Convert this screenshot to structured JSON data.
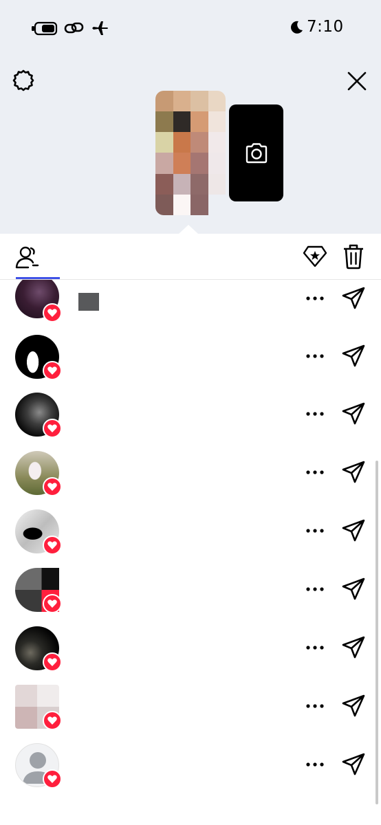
{
  "status_bar": {
    "time": "7:10",
    "icons": [
      "battery-icon",
      "link-icon",
      "airplane-icon",
      "moon-icon"
    ]
  },
  "header": {
    "left_icon": "gear-icon",
    "right_icon": "close-icon",
    "story_preview": "pixelated-story-thumbnail",
    "add_story_icon": "camera-icon"
  },
  "tabs": {
    "active": "viewers-icon",
    "actions": [
      "diamond-star-icon",
      "trash-icon"
    ],
    "accent_color": "#3f51e6"
  },
  "viewers": [
    {
      "avatar": "dark-concert-photo",
      "reaction": "heart",
      "name_redacted": true
    },
    {
      "avatar": "white-silhouette",
      "reaction": "heart"
    },
    {
      "avatar": "dark-portrait",
      "reaction": "heart"
    },
    {
      "avatar": "white-rabbit",
      "reaction": "heart"
    },
    {
      "avatar": "black-horse",
      "reaction": "heart"
    },
    {
      "avatar": "grey-red-blocks",
      "reaction": "heart"
    },
    {
      "avatar": "dark-object",
      "reaction": "heart"
    },
    {
      "avatar": "pale-blocks",
      "reaction": "heart"
    },
    {
      "avatar": "default-person",
      "reaction": "heart"
    }
  ],
  "colors": {
    "header_bg": "#eceff4",
    "heart": "#ff1f3d",
    "camera_card": "#000000"
  }
}
